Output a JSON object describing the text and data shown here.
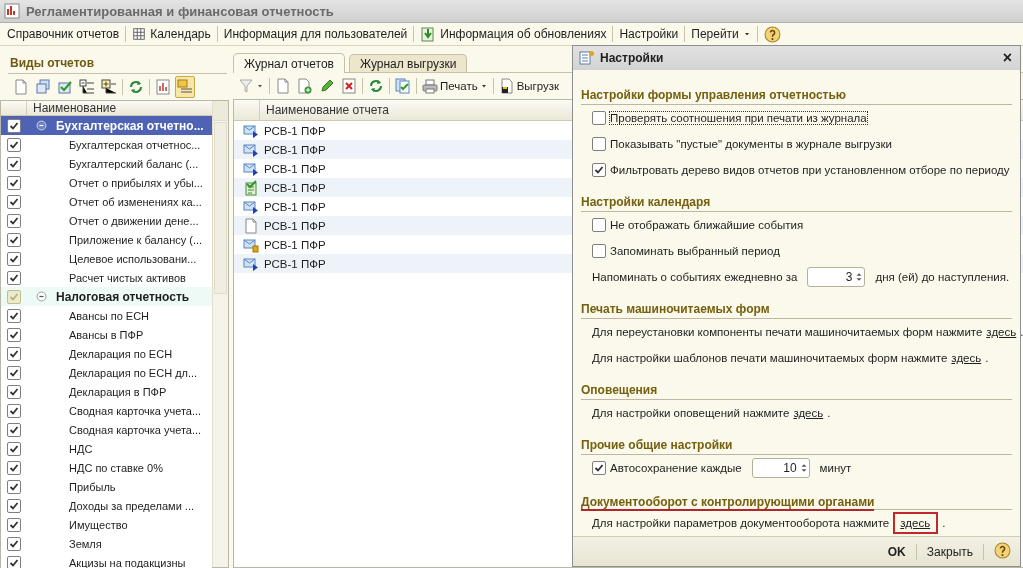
{
  "window": {
    "title": "Регламентированная и финансовая отчетность"
  },
  "menu": [
    {
      "label": "Справочник отчетов",
      "dropdown": false
    },
    {
      "label": "Календарь",
      "dropdown": false
    },
    {
      "label": "Информация для пользователей",
      "dropdown": false
    },
    {
      "label": "Информация об обновлениях",
      "dropdown": false
    },
    {
      "label": "Настройки",
      "dropdown": false
    },
    {
      "label": "Перейти",
      "dropdown": true
    }
  ],
  "report_types": {
    "title": "Виды отчетов",
    "column": "Наименование",
    "items": [
      {
        "label": "Бухгалтерская отчетно...",
        "checked": true,
        "greyed": false,
        "selected": true,
        "expanded": true,
        "children": [
          {
            "label": "Бухгалтерская отчетнос...",
            "checked": true,
            "greyed": false,
            "selected": false
          },
          {
            "label": "Бухгалтерский баланс (...",
            "checked": true,
            "greyed": false,
            "selected": false
          },
          {
            "label": "Отчет о прибылях и убы...",
            "checked": true,
            "greyed": false,
            "selected": false
          },
          {
            "label": "Отчет об изменениях ка...",
            "checked": true,
            "greyed": false,
            "selected": false
          },
          {
            "label": "Отчет о движении дене...",
            "checked": true,
            "greyed": false,
            "selected": false
          },
          {
            "label": "Приложение к балансу (...",
            "checked": true,
            "greyed": false,
            "selected": false
          },
          {
            "label": "Целевое использовани...",
            "checked": true,
            "greyed": false,
            "selected": false
          },
          {
            "label": "Расчет чистых активов",
            "checked": true,
            "greyed": false,
            "selected": false
          }
        ]
      },
      {
        "label": "Налоговая отчетность",
        "checked": true,
        "greyed": true,
        "selected": false,
        "expanded": true,
        "children": [
          {
            "label": "Авансы по ЕСН",
            "checked": true,
            "greyed": false,
            "selected": false
          },
          {
            "label": "Авансы в ПФР",
            "checked": true,
            "greyed": false,
            "selected": false
          },
          {
            "label": "Декларация по ЕСН",
            "checked": true,
            "greyed": false,
            "selected": false
          },
          {
            "label": "Декларация по ЕСН дл...",
            "checked": true,
            "greyed": false,
            "selected": false
          },
          {
            "label": "Декларация в ПФР",
            "checked": true,
            "greyed": false,
            "selected": false
          },
          {
            "label": "Сводная карточка учета...",
            "checked": true,
            "greyed": false,
            "selected": false
          },
          {
            "label": "Сводная карточка учета...",
            "checked": true,
            "greyed": false,
            "selected": false
          },
          {
            "label": "НДС",
            "checked": true,
            "greyed": false,
            "selected": false
          },
          {
            "label": "НДС по ставке 0%",
            "checked": true,
            "greyed": false,
            "selected": false
          },
          {
            "label": "Прибыль",
            "checked": true,
            "greyed": false,
            "selected": false
          },
          {
            "label": "Доходы за пределами ...",
            "checked": true,
            "greyed": false,
            "selected": false
          },
          {
            "label": "Имущество",
            "checked": true,
            "greyed": false,
            "selected": false
          },
          {
            "label": "Земля",
            "checked": true,
            "greyed": false,
            "selected": false
          },
          {
            "label": "Акцизы на подакцизны",
            "checked": true,
            "greyed": false,
            "selected": false
          }
        ]
      }
    ]
  },
  "journal": {
    "tabs": [
      {
        "label": "Журнал отчетов",
        "selected": true
      },
      {
        "label": "Журнал выгрузки",
        "selected": false
      }
    ],
    "toolbar": [
      {
        "label": "Печать",
        "dropdown": true
      },
      {
        "label": "Выгрузк",
        "dropdown": false
      }
    ],
    "column": "Наименование отчета",
    "rows": [
      {
        "name": "РСВ-1 ПФР",
        "kind": "sent"
      },
      {
        "name": "РСВ-1 ПФР",
        "kind": "sent"
      },
      {
        "name": "РСВ-1 ПФР",
        "kind": "sent"
      },
      {
        "name": "РСВ-1 ПФР",
        "kind": "accepted"
      },
      {
        "name": "РСВ-1 ПФР",
        "kind": "sent"
      },
      {
        "name": "РСВ-1 ПФР",
        "kind": "draft"
      },
      {
        "name": "РСВ-1 ПФР",
        "kind": "pending"
      },
      {
        "name": "РСВ-1 ПФР",
        "kind": "sent"
      }
    ]
  },
  "settings_dialog": {
    "title": "Настройки",
    "close": "×",
    "sections": [
      {
        "heading": "Настройки формы управления отчетностью",
        "highlighted": false,
        "items": [
          {
            "kind": "checkbox",
            "label": "Проверять соотношения при печати из журнала",
            "checked": false,
            "focused": true
          },
          {
            "kind": "checkbox",
            "label": "Показывать \"пустые\" документы в журнале выгрузки",
            "checked": false,
            "focused": false
          },
          {
            "kind": "checkbox",
            "label": "Фильтровать дерево видов отчетов при установленном отборе по периоду",
            "checked": true,
            "focused": false
          }
        ]
      },
      {
        "heading": "Настройки календаря",
        "highlighted": false,
        "items": [
          {
            "kind": "checkbox",
            "label": "Не отображать ближайшие события",
            "checked": false,
            "focused": false
          },
          {
            "kind": "checkbox",
            "label": "Запоминать выбранный период",
            "checked": false,
            "focused": false
          },
          {
            "kind": "spinner",
            "label": "Напоминать о событиях ежедневно за",
            "value": "3",
            "suffix": "дня (ей) до наступления."
          }
        ]
      },
      {
        "heading": "Печать машиночитаемых форм",
        "highlighted": false,
        "items": [
          {
            "kind": "link",
            "text": "Для переустановки компоненты печати машиночитаемых форм нажмите",
            "link": "здесь",
            "end": ".",
            "highlighted": false
          },
          {
            "kind": "link",
            "text": "Для настройки шаблонов печати машиночитаемых форм нажмите",
            "link": "здесь",
            "end": ".",
            "highlighted": false
          }
        ]
      },
      {
        "heading": "Оповещения",
        "highlighted": false,
        "items": [
          {
            "kind": "link",
            "text": "Для настройки оповещений нажмите",
            "link": "здесь",
            "end": ".",
            "highlighted": false
          }
        ]
      },
      {
        "heading": "Прочие общие настройки",
        "highlighted": false,
        "items": [
          {
            "kind": "checkspin",
            "label": "Автосохранение каждые",
            "checked": true,
            "value": "10",
            "suffix": "минут"
          }
        ]
      },
      {
        "heading": "Документооборот с контролирующими органами",
        "highlighted": true,
        "items": [
          {
            "kind": "link",
            "text": "Для настройки параметров документооборота нажмите",
            "link": "здесь",
            "end": ".",
            "highlighted": true
          }
        ]
      }
    ],
    "buttons": [
      {
        "label": "OK",
        "default": true
      },
      {
        "label": "Закрыть",
        "default": false
      }
    ]
  }
}
